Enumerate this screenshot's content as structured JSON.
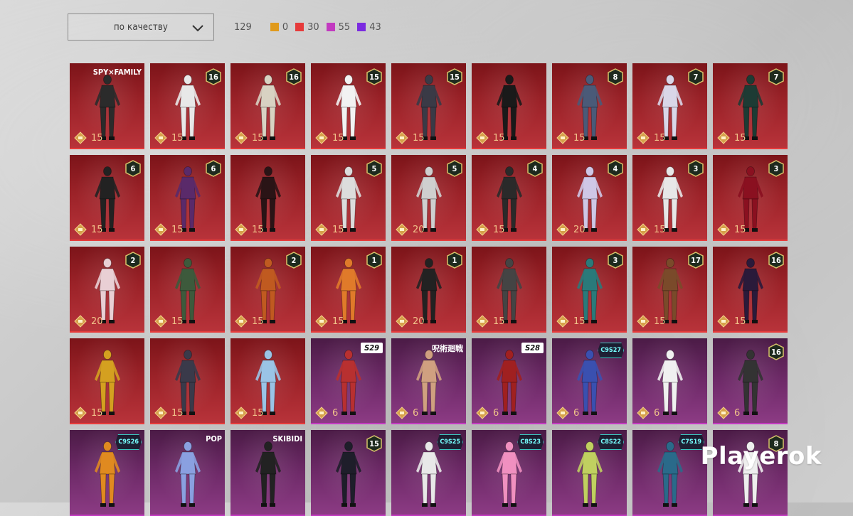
{
  "filter": {
    "sort_label": "по качеству",
    "icon": "chevron-down-icon"
  },
  "stats": {
    "total": "129",
    "items": [
      {
        "color": "#e09a1c",
        "value": "0"
      },
      {
        "color": "#e63b3b",
        "value": "30"
      },
      {
        "color": "#c23ac0",
        "value": "55"
      },
      {
        "color": "#7b2be0",
        "value": "43"
      }
    ]
  },
  "cards": [
    {
      "theme": "red",
      "price": "15",
      "tag": "SPY×FAMILY"
    },
    {
      "theme": "red",
      "price": "15",
      "level": "16"
    },
    {
      "theme": "red",
      "price": "15",
      "level": "16"
    },
    {
      "theme": "red",
      "price": "15",
      "level": "15"
    },
    {
      "theme": "red",
      "price": "15",
      "level": "15"
    },
    {
      "theme": "red",
      "price": "15"
    },
    {
      "theme": "red",
      "price": "15",
      "level": "8"
    },
    {
      "theme": "red",
      "price": "15",
      "level": "7"
    },
    {
      "theme": "red",
      "price": "15",
      "level": "7"
    },
    {
      "theme": "red",
      "price": "15",
      "level": "6"
    },
    {
      "theme": "red",
      "price": "15",
      "level": "6"
    },
    {
      "theme": "red",
      "price": "15"
    },
    {
      "theme": "red",
      "price": "15",
      "level": "5"
    },
    {
      "theme": "red",
      "price": "20",
      "level": "5"
    },
    {
      "theme": "red",
      "price": "15",
      "level": "4"
    },
    {
      "theme": "red",
      "price": "20",
      "level": "4"
    },
    {
      "theme": "red",
      "price": "15",
      "level": "3"
    },
    {
      "theme": "red",
      "price": "15",
      "level": "3"
    },
    {
      "theme": "red",
      "price": "20",
      "level": "2"
    },
    {
      "theme": "red",
      "price": "15"
    },
    {
      "theme": "red",
      "price": "15",
      "level": "2"
    },
    {
      "theme": "red",
      "price": "15",
      "level": "1"
    },
    {
      "theme": "red",
      "price": "20",
      "level": "1"
    },
    {
      "theme": "red",
      "price": "15"
    },
    {
      "theme": "red",
      "price": "15",
      "level": "3"
    },
    {
      "theme": "red",
      "price": "15",
      "level": "17"
    },
    {
      "theme": "red",
      "price": "15",
      "level": "16"
    },
    {
      "theme": "red",
      "price": "15"
    },
    {
      "theme": "red",
      "price": "15"
    },
    {
      "theme": "red",
      "price": "15"
    },
    {
      "theme": "purple",
      "price": "6",
      "tag": "S29",
      "tag_style": "box"
    },
    {
      "theme": "purple",
      "price": "6",
      "tag": "呪術廻戦"
    },
    {
      "theme": "purple",
      "price": "6",
      "tag": "S28",
      "tag_style": "box"
    },
    {
      "theme": "purple",
      "price": "6",
      "tag": "C9S27",
      "tag_style": "season"
    },
    {
      "theme": "purple",
      "price": "6"
    },
    {
      "theme": "purple",
      "price": "6",
      "level": "16"
    },
    {
      "theme": "purple",
      "tag": "C9S26",
      "tag_style": "season"
    },
    {
      "theme": "purple",
      "tag": "POP"
    },
    {
      "theme": "purple",
      "tag": "SKIBIDI"
    },
    {
      "theme": "purple",
      "level": "15"
    },
    {
      "theme": "purple",
      "tag": "C9S25",
      "tag_style": "season"
    },
    {
      "theme": "purple",
      "tag": "C8S23",
      "tag_style": "season"
    },
    {
      "theme": "purple",
      "tag": "C8S22",
      "tag_style": "season"
    },
    {
      "theme": "purple",
      "tag": "C7S19",
      "tag_style": "season"
    },
    {
      "theme": "purple",
      "level": "8"
    }
  ],
  "watermark": "Playerok"
}
